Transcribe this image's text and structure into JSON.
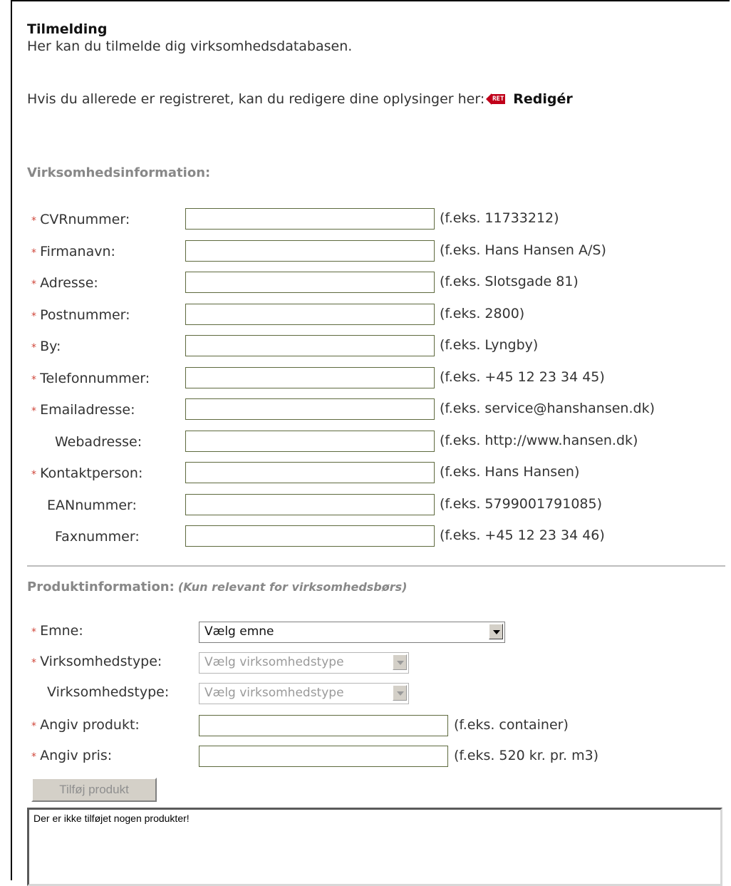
{
  "header": {
    "title": "Tilmelding",
    "intro": "Her kan du tilmelde dig virksomhedsdatabasen.",
    "edit_prompt": "Hvis du allerede er registreret, kan du redigere dine oplysinger her:",
    "edit_icon_text": "RET",
    "edit_link": "Redigér"
  },
  "company": {
    "section_title": "Virksomhedsinformation:",
    "fields": [
      {
        "label": "CVRnummer:",
        "required": "*",
        "example": "(f.eks. 11733212)"
      },
      {
        "label": "Firmanavn:",
        "required": "*",
        "example": "(f.eks. Hans Hansen A/S)"
      },
      {
        "label": "Adresse:",
        "required": "*",
        "example": "(f.eks. Slotsgade 81)"
      },
      {
        "label": "Postnummer:",
        "required": "*",
        "example": "(f.eks. 2800)"
      },
      {
        "label": "By:",
        "required": "*",
        "example": "(f.eks. Lyngby)"
      },
      {
        "label": "Telefonnummer:",
        "required": "*",
        "example": "(f.eks. +45 12 23 34 45)"
      },
      {
        "label": "Emailadresse:",
        "required": "*",
        "example": "(f.eks. service@hanshansen.dk)"
      },
      {
        "label": "Webadresse:",
        "required": "",
        "example": "(f.eks. http://www.hansen.dk)"
      },
      {
        "label": "Kontaktperson:",
        "required": "*",
        "example": "(f.eks. Hans Hansen)"
      },
      {
        "label": "EANnummer:",
        "required": "",
        "example": "(f.eks. 5799001791085)"
      },
      {
        "label": "Faxnummer:",
        "required": "",
        "example": "(f.eks. +45 12 23 34 46)"
      }
    ]
  },
  "product": {
    "section_title": "Produktinformation:",
    "section_note": "(Kun relevant for virksomhedsbørs)",
    "subject_label": "Emne:",
    "subject_value": "Vælg emne",
    "type1_label": "Virksomhedstype:",
    "type1_value": "Vælg virksomhedstype",
    "type2_label": "Virksomhedstype:",
    "type2_value": "Vælg virksomhedstype",
    "product_label": "Angiv produkt:",
    "product_example": "(f.eks. container)",
    "price_label": "Angiv pris:",
    "price_example": "(f.eks. 520 kr. pr. m3)",
    "required_mark": "*",
    "add_button": "Tilføj produkt",
    "list_text": "Der er ikke tilføjet nogen produkter!"
  },
  "colors": {
    "required": "#d0463a",
    "section_title": "#888888",
    "input_border": "#5e6a3e",
    "edit_icon": "#c0001a"
  }
}
